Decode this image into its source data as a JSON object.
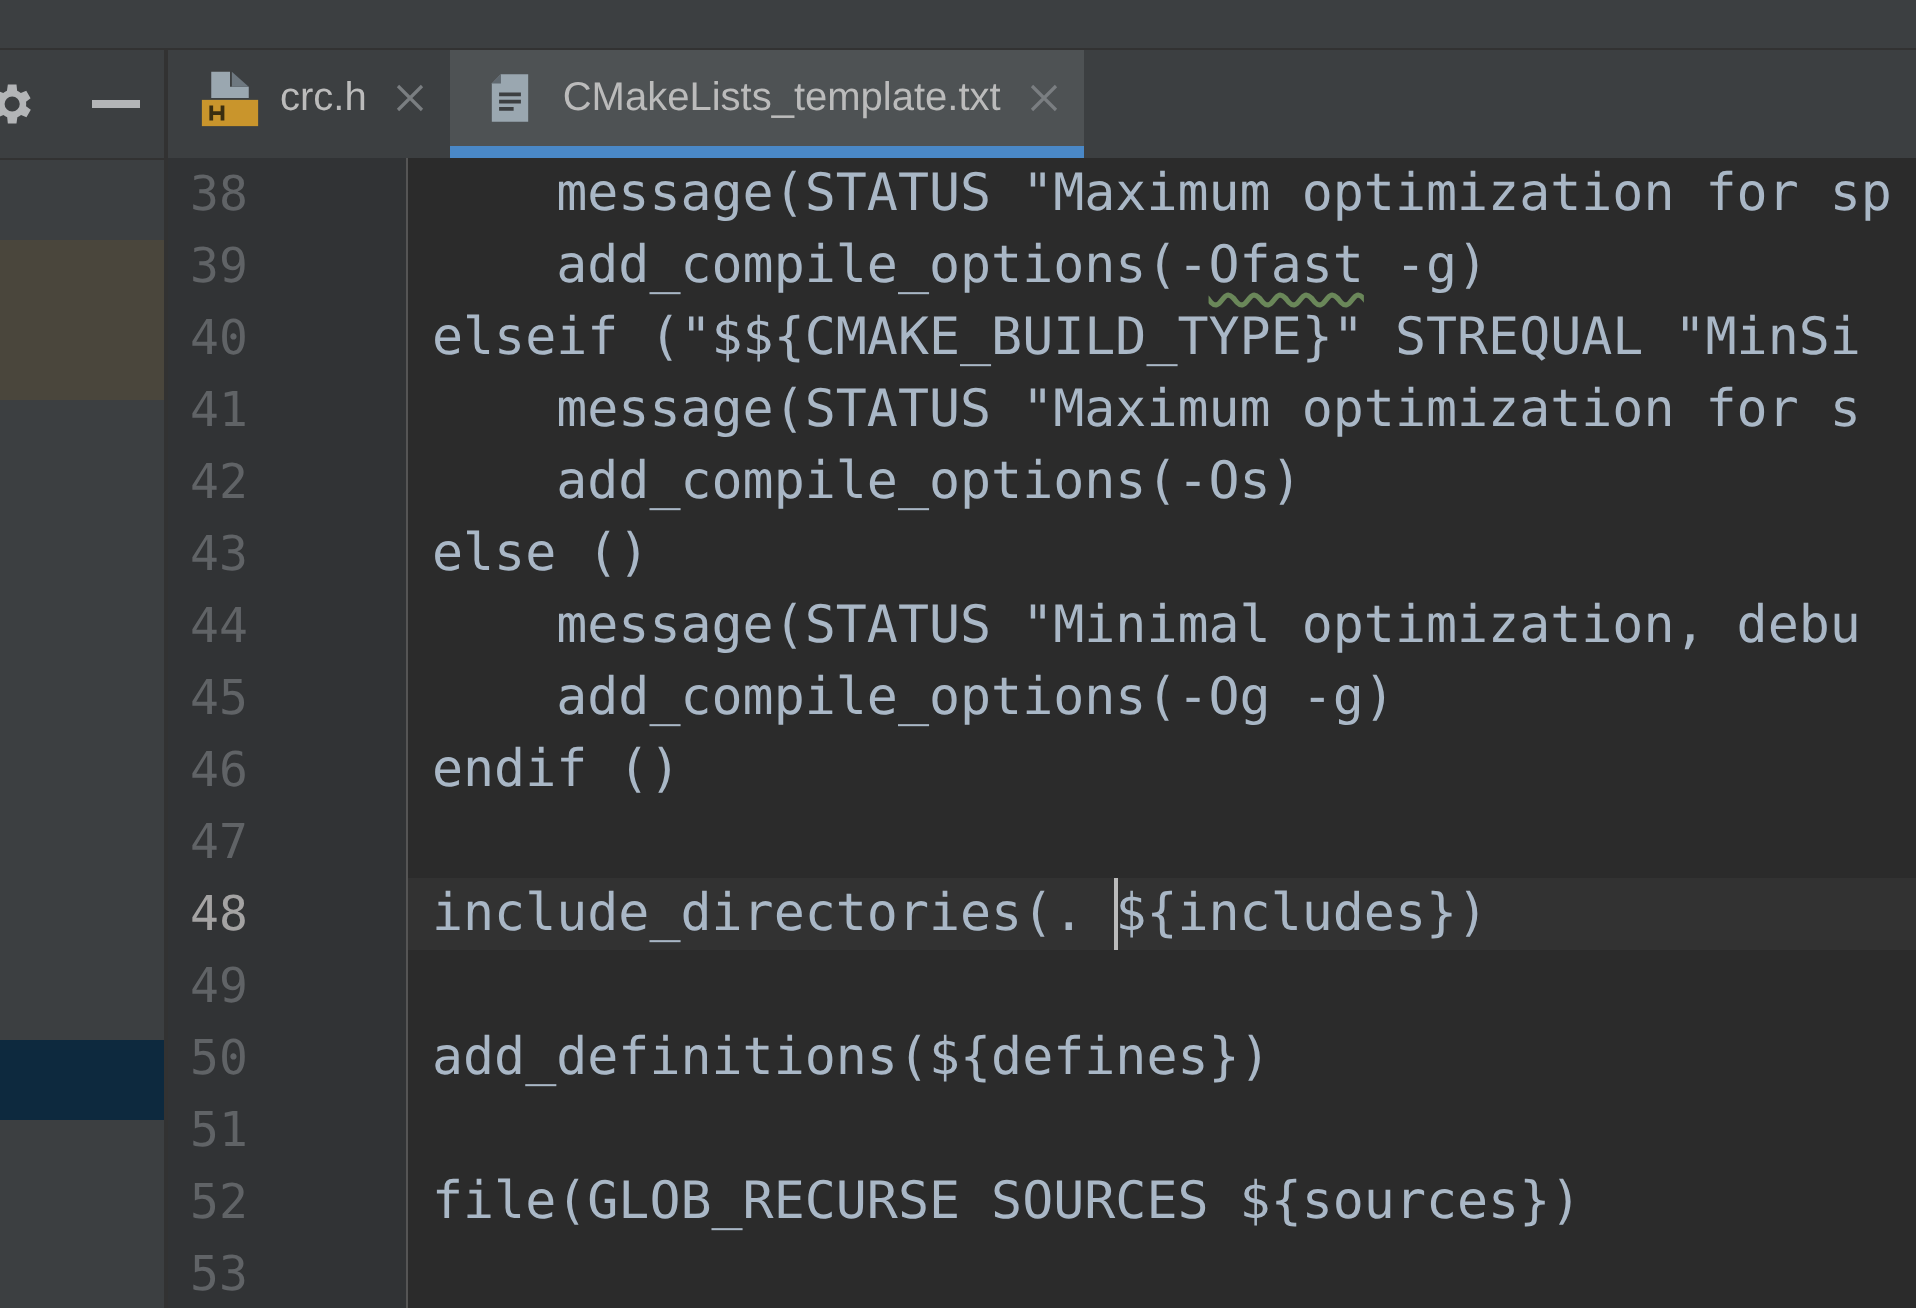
{
  "tabs": [
    {
      "label": "crc.h",
      "kind": "header",
      "selected": false
    },
    {
      "label": "CMakeLists_template.txt",
      "kind": "text",
      "selected": true
    }
  ],
  "editor": {
    "lines": [
      {
        "number": "38",
        "current": false,
        "parts": [
          {
            "text": "    message(STATUS \"Maximum optimization for sp"
          }
        ]
      },
      {
        "number": "39",
        "current": false,
        "parts": [
          {
            "text": "    add_compile_options(-"
          },
          {
            "text": "Ofast",
            "kind": "typo"
          },
          {
            "text": " -g)"
          }
        ]
      },
      {
        "number": "40",
        "current": false,
        "parts": [
          {
            "text": "elseif (\"$${CMAKE_BUILD_TYPE}\" STREQUAL \"MinSi"
          }
        ]
      },
      {
        "number": "41",
        "current": false,
        "parts": [
          {
            "text": "    message(STATUS \"Maximum optimization for s"
          }
        ]
      },
      {
        "number": "42",
        "current": false,
        "parts": [
          {
            "text": "    add_compile_options(-Os)"
          }
        ]
      },
      {
        "number": "43",
        "current": false,
        "parts": [
          {
            "text": "else ()"
          }
        ]
      },
      {
        "number": "44",
        "current": false,
        "parts": [
          {
            "text": "    message(STATUS \"Minimal optimization, debu"
          }
        ]
      },
      {
        "number": "45",
        "current": false,
        "parts": [
          {
            "text": "    add_compile_options(-Og -g)"
          }
        ]
      },
      {
        "number": "46",
        "current": false,
        "parts": [
          {
            "text": "endif ()"
          }
        ]
      },
      {
        "number": "47",
        "current": false
      },
      {
        "number": "48",
        "current": true,
        "parts": [
          {
            "text": "include_directories(. "
          },
          {
            "text": "${includes})",
            "kind": "caret"
          }
        ]
      },
      {
        "number": "49",
        "current": false
      },
      {
        "number": "50",
        "current": false,
        "parts": [
          {
            "text": "add_definitions(${defines})"
          }
        ]
      },
      {
        "number": "51",
        "current": false
      },
      {
        "number": "52",
        "current": false,
        "parts": [
          {
            "text": "file(GLOB_RECURSE SOURCES ${sources})"
          }
        ]
      },
      {
        "number": "53",
        "current": false
      }
    ]
  }
}
